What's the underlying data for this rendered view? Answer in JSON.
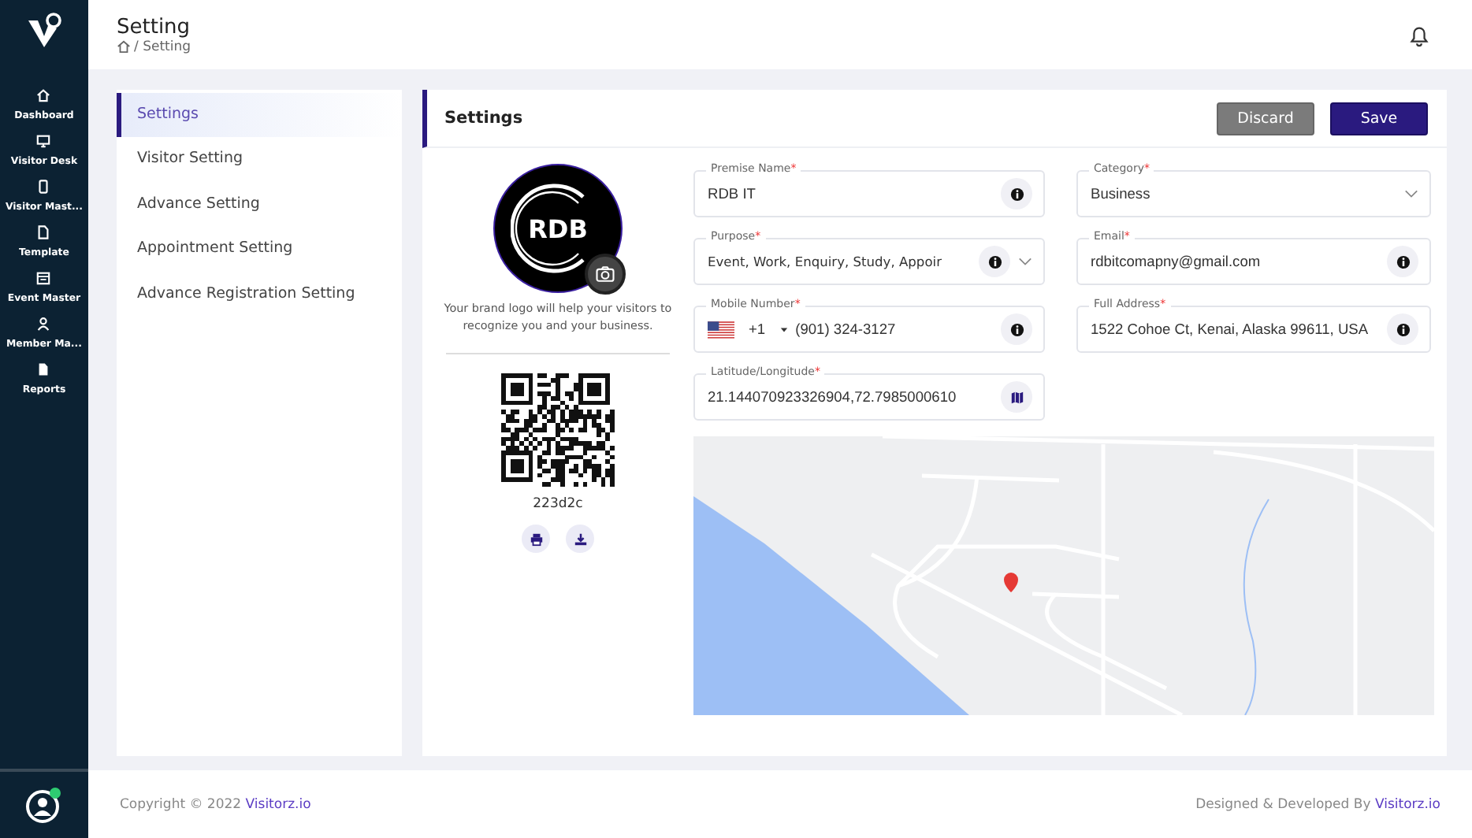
{
  "sidebar": {
    "items": [
      {
        "label": "Dashboard"
      },
      {
        "label": "Visitor Desk"
      },
      {
        "label": "Visitor Mast..."
      },
      {
        "label": "Template"
      },
      {
        "label": "Event Master"
      },
      {
        "label": "Member Ma..."
      },
      {
        "label": "Reports"
      }
    ]
  },
  "header": {
    "title": "Setting",
    "breadcrumb": "/ Setting"
  },
  "settings_menu": [
    {
      "label": "Settings",
      "selected": true
    },
    {
      "label": "Visitor Setting",
      "selected": false
    },
    {
      "label": "Advance Setting",
      "selected": false
    },
    {
      "label": "Appointment Setting",
      "selected": false
    },
    {
      "label": "Advance Registration Setting",
      "selected": false
    }
  ],
  "card": {
    "title": "Settings",
    "buttons": [
      {
        "label": "Discard",
        "kind": "secondary"
      },
      {
        "label": "Save",
        "kind": "primary"
      }
    ]
  },
  "logo": {
    "text": "RDB",
    "caption": "Your brand logo will help your visitors to recognize you and your business."
  },
  "qr": {
    "code": "223d2c"
  },
  "fields": [
    {
      "kind": "text",
      "label": "Premise Name",
      "mark": "*",
      "value": "RDB IT"
    },
    {
      "kind": "select",
      "label": "Category",
      "mark": "*",
      "value": "Business"
    },
    {
      "kind": "select-info",
      "label": "Purpose",
      "mark": "*",
      "value": "Event, Work, Enquiry, Study, Appoir"
    },
    {
      "kind": "text",
      "label": "Email",
      "mark": "*",
      "value": "rdbitcomapny@gmail.com"
    },
    {
      "kind": "phone",
      "label": "Mobile Number",
      "mark": "*",
      "code": "+1",
      "value": "(901) 324-3127"
    },
    {
      "kind": "text",
      "label": "Full Address",
      "mark": "*",
      "value": "1522 Cohoe Ct, Kenai, Alaska 99611, USA"
    },
    {
      "kind": "map",
      "label": "Latitude/Longitude",
      "mark": "*",
      "value": "21.144070923326904,72.7985000610"
    }
  ],
  "footer": {
    "copyright": "Copyright © 2022",
    "link": "Visitorz.io",
    "credit": "Designed & Developed By",
    "credit_link": "Visitorz.io"
  }
}
